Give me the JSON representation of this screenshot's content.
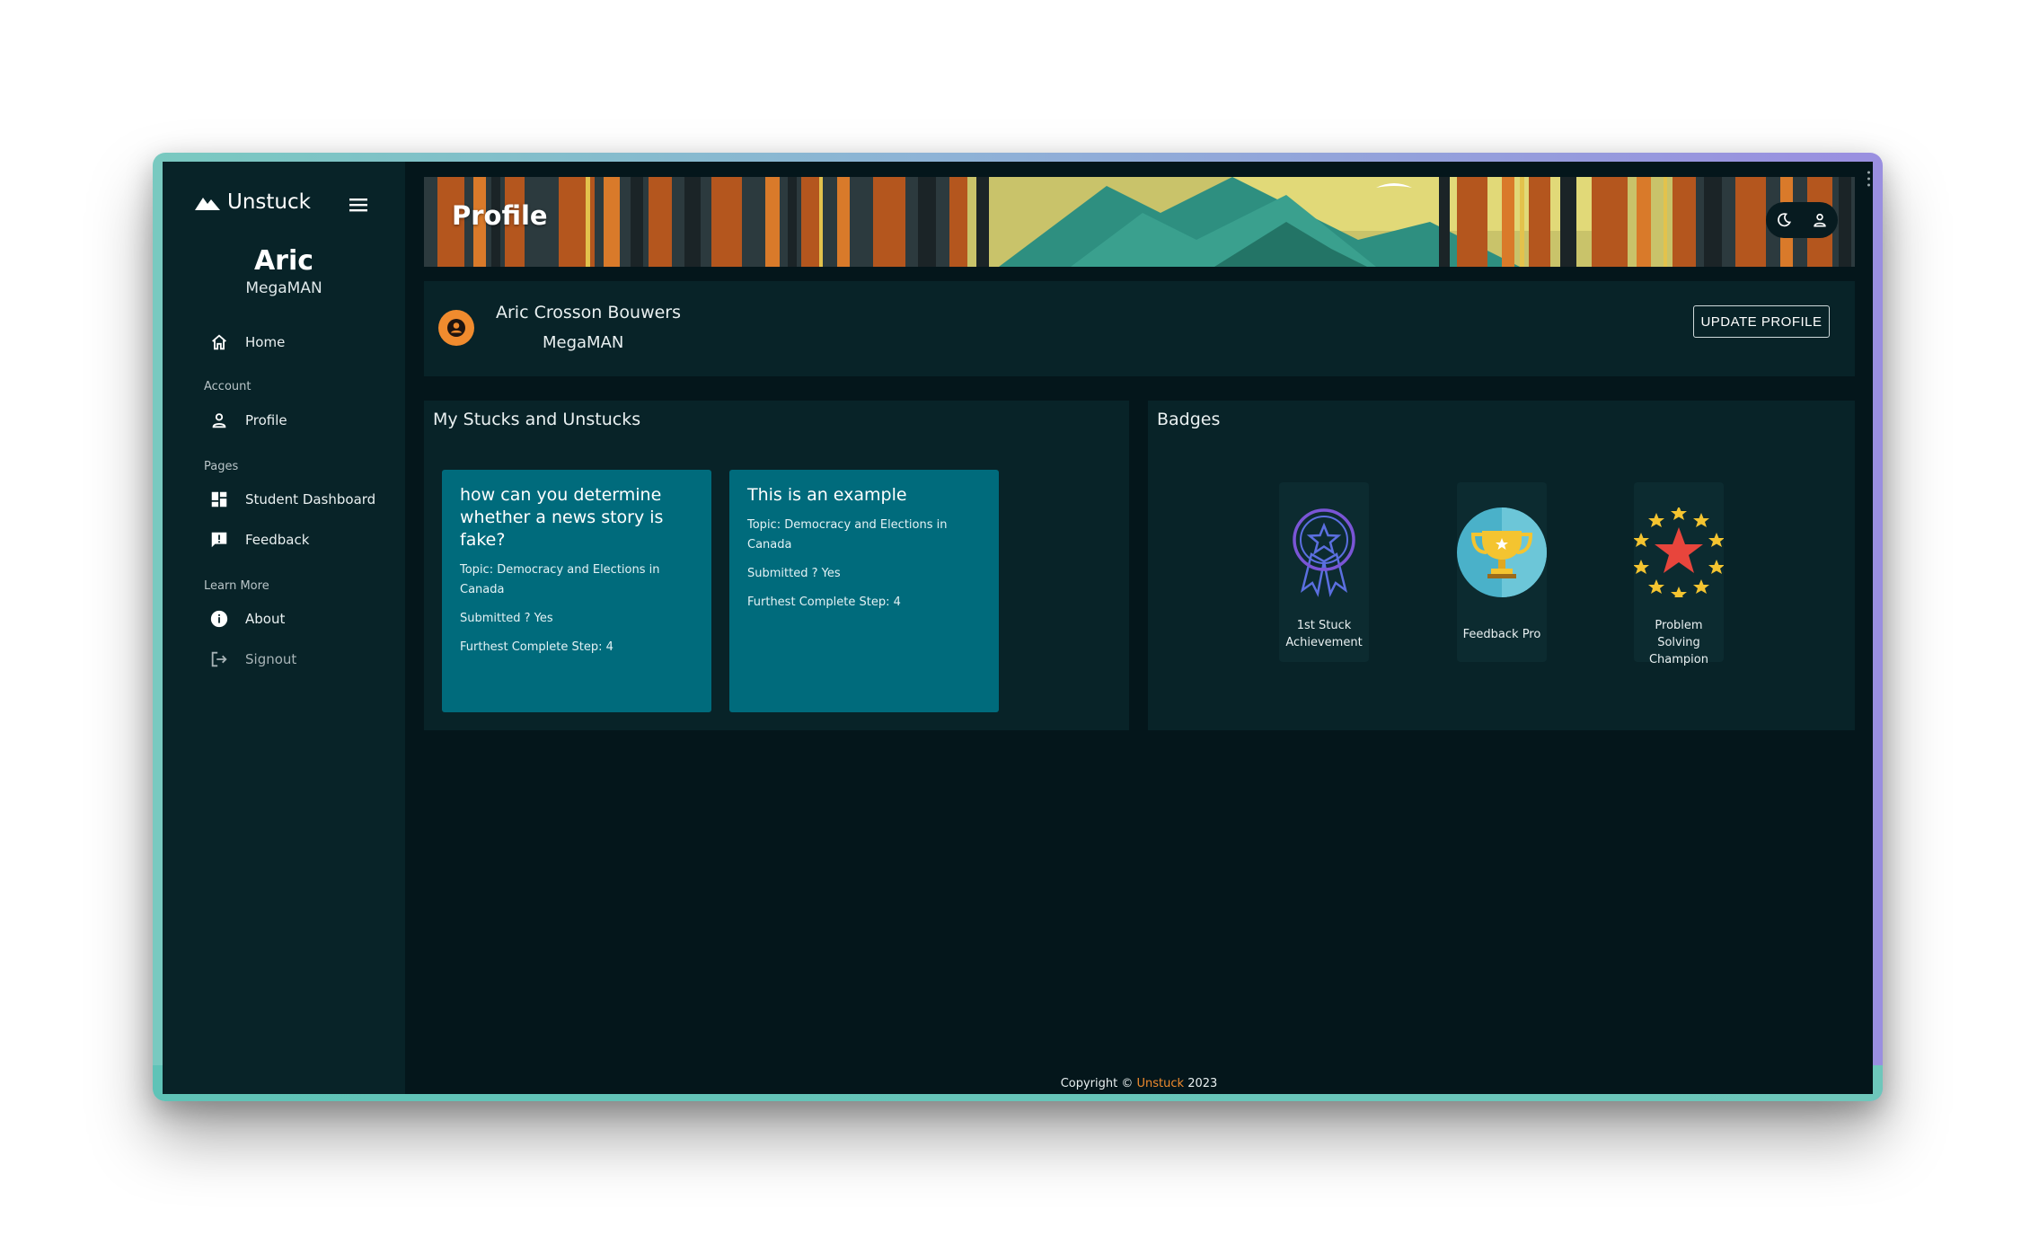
{
  "app": {
    "brand": "Unstuck"
  },
  "sidebar": {
    "user_name": "Aric",
    "user_nick": "MegaMAN",
    "home": "Home",
    "section_account": "Account",
    "profile": "Profile",
    "section_pages": "Pages",
    "student_dashboard": "Student Dashboard",
    "feedback": "Feedback",
    "section_learn_more": "Learn More",
    "about": "About",
    "signout": "Signout"
  },
  "header": {
    "title": "Profile"
  },
  "profile": {
    "full_name": "Aric Crosson Bouwers",
    "nickname": "MegaMAN",
    "update_label": "UPDATE PROFILE"
  },
  "stucks": {
    "title": "My Stucks and Unstucks",
    "items": [
      {
        "title": "how can you determine whether a news story is fake?",
        "topic": "Topic: Democracy and Elections in Canada",
        "submitted": "Submitted ? Yes",
        "step": "Furthest Complete Step: 4"
      },
      {
        "title": "This is an example",
        "topic": "Topic: Democracy and Elections in Canada",
        "submitted": "Submitted ? Yes",
        "step": "Furthest Complete Step: 4"
      }
    ]
  },
  "badges": {
    "title": "Badges",
    "items": [
      {
        "label": "1st Stuck Achievement",
        "icon": "ribbon-award-icon"
      },
      {
        "label": "Feedback Pro",
        "icon": "trophy-icon"
      },
      {
        "label": "Problem Solving Champion",
        "icon": "star-ring-icon"
      }
    ]
  },
  "footer": {
    "prefix": "Copyright ©",
    "link": "Unstuck",
    "year": "2023"
  },
  "colors": {
    "background": "#04161b",
    "sidebar": "#082328",
    "card": "#006b7c",
    "accent": "#f08b2e"
  }
}
